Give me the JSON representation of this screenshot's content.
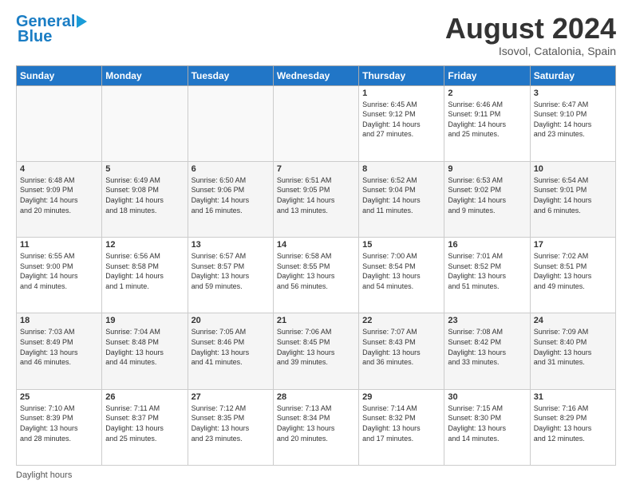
{
  "header": {
    "logo_line1": "General",
    "logo_line2": "Blue",
    "month_year": "August 2024",
    "location": "Isovol, Catalonia, Spain"
  },
  "days_of_week": [
    "Sunday",
    "Monday",
    "Tuesday",
    "Wednesday",
    "Thursday",
    "Friday",
    "Saturday"
  ],
  "weeks": [
    [
      {
        "day": "",
        "info": ""
      },
      {
        "day": "",
        "info": ""
      },
      {
        "day": "",
        "info": ""
      },
      {
        "day": "",
        "info": ""
      },
      {
        "day": "1",
        "info": "Sunrise: 6:45 AM\nSunset: 9:12 PM\nDaylight: 14 hours\nand 27 minutes."
      },
      {
        "day": "2",
        "info": "Sunrise: 6:46 AM\nSunset: 9:11 PM\nDaylight: 14 hours\nand 25 minutes."
      },
      {
        "day": "3",
        "info": "Sunrise: 6:47 AM\nSunset: 9:10 PM\nDaylight: 14 hours\nand 23 minutes."
      }
    ],
    [
      {
        "day": "4",
        "info": "Sunrise: 6:48 AM\nSunset: 9:09 PM\nDaylight: 14 hours\nand 20 minutes."
      },
      {
        "day": "5",
        "info": "Sunrise: 6:49 AM\nSunset: 9:08 PM\nDaylight: 14 hours\nand 18 minutes."
      },
      {
        "day": "6",
        "info": "Sunrise: 6:50 AM\nSunset: 9:06 PM\nDaylight: 14 hours\nand 16 minutes."
      },
      {
        "day": "7",
        "info": "Sunrise: 6:51 AM\nSunset: 9:05 PM\nDaylight: 14 hours\nand 13 minutes."
      },
      {
        "day": "8",
        "info": "Sunrise: 6:52 AM\nSunset: 9:04 PM\nDaylight: 14 hours\nand 11 minutes."
      },
      {
        "day": "9",
        "info": "Sunrise: 6:53 AM\nSunset: 9:02 PM\nDaylight: 14 hours\nand 9 minutes."
      },
      {
        "day": "10",
        "info": "Sunrise: 6:54 AM\nSunset: 9:01 PM\nDaylight: 14 hours\nand 6 minutes."
      }
    ],
    [
      {
        "day": "11",
        "info": "Sunrise: 6:55 AM\nSunset: 9:00 PM\nDaylight: 14 hours\nand 4 minutes."
      },
      {
        "day": "12",
        "info": "Sunrise: 6:56 AM\nSunset: 8:58 PM\nDaylight: 14 hours\nand 1 minute."
      },
      {
        "day": "13",
        "info": "Sunrise: 6:57 AM\nSunset: 8:57 PM\nDaylight: 13 hours\nand 59 minutes."
      },
      {
        "day": "14",
        "info": "Sunrise: 6:58 AM\nSunset: 8:55 PM\nDaylight: 13 hours\nand 56 minutes."
      },
      {
        "day": "15",
        "info": "Sunrise: 7:00 AM\nSunset: 8:54 PM\nDaylight: 13 hours\nand 54 minutes."
      },
      {
        "day": "16",
        "info": "Sunrise: 7:01 AM\nSunset: 8:52 PM\nDaylight: 13 hours\nand 51 minutes."
      },
      {
        "day": "17",
        "info": "Sunrise: 7:02 AM\nSunset: 8:51 PM\nDaylight: 13 hours\nand 49 minutes."
      }
    ],
    [
      {
        "day": "18",
        "info": "Sunrise: 7:03 AM\nSunset: 8:49 PM\nDaylight: 13 hours\nand 46 minutes."
      },
      {
        "day": "19",
        "info": "Sunrise: 7:04 AM\nSunset: 8:48 PM\nDaylight: 13 hours\nand 44 minutes."
      },
      {
        "day": "20",
        "info": "Sunrise: 7:05 AM\nSunset: 8:46 PM\nDaylight: 13 hours\nand 41 minutes."
      },
      {
        "day": "21",
        "info": "Sunrise: 7:06 AM\nSunset: 8:45 PM\nDaylight: 13 hours\nand 39 minutes."
      },
      {
        "day": "22",
        "info": "Sunrise: 7:07 AM\nSunset: 8:43 PM\nDaylight: 13 hours\nand 36 minutes."
      },
      {
        "day": "23",
        "info": "Sunrise: 7:08 AM\nSunset: 8:42 PM\nDaylight: 13 hours\nand 33 minutes."
      },
      {
        "day": "24",
        "info": "Sunrise: 7:09 AM\nSunset: 8:40 PM\nDaylight: 13 hours\nand 31 minutes."
      }
    ],
    [
      {
        "day": "25",
        "info": "Sunrise: 7:10 AM\nSunset: 8:39 PM\nDaylight: 13 hours\nand 28 minutes."
      },
      {
        "day": "26",
        "info": "Sunrise: 7:11 AM\nSunset: 8:37 PM\nDaylight: 13 hours\nand 25 minutes."
      },
      {
        "day": "27",
        "info": "Sunrise: 7:12 AM\nSunset: 8:35 PM\nDaylight: 13 hours\nand 23 minutes."
      },
      {
        "day": "28",
        "info": "Sunrise: 7:13 AM\nSunset: 8:34 PM\nDaylight: 13 hours\nand 20 minutes."
      },
      {
        "day": "29",
        "info": "Sunrise: 7:14 AM\nSunset: 8:32 PM\nDaylight: 13 hours\nand 17 minutes."
      },
      {
        "day": "30",
        "info": "Sunrise: 7:15 AM\nSunset: 8:30 PM\nDaylight: 13 hours\nand 14 minutes."
      },
      {
        "day": "31",
        "info": "Sunrise: 7:16 AM\nSunset: 8:29 PM\nDaylight: 13 hours\nand 12 minutes."
      }
    ]
  ],
  "footer": {
    "daylight_label": "Daylight hours"
  }
}
